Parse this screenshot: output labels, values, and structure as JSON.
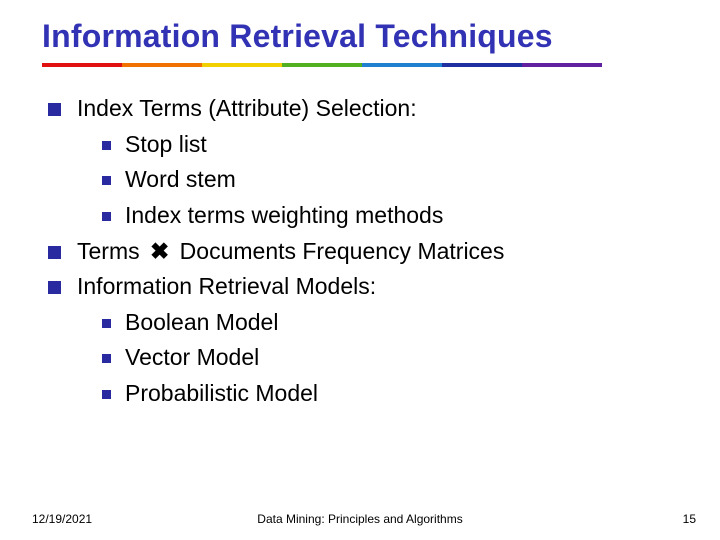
{
  "title": "Information Retrieval Techniques",
  "rainbow": [
    "#e01010",
    "#f07000",
    "#f0d000",
    "#50b020",
    "#2080d0",
    "#2030a0",
    "#6020a0"
  ],
  "bullets": {
    "b1": "Index Terms (Attribute) Selection:",
    "b1_1": "Stop list",
    "b1_2": "Word stem",
    "b1_3": "Index terms weighting methods",
    "b2_pre": "Terms ",
    "b2_sym": "✖",
    "b2_post": " Documents Frequency Matrices",
    "b3": "Information Retrieval Models:",
    "b3_1": "Boolean Model",
    "b3_2": "Vector Model",
    "b3_3": "Probabilistic Model"
  },
  "footer": {
    "date": "12/19/2021",
    "center": "Data Mining: Principles and Algorithms",
    "page": "15"
  }
}
